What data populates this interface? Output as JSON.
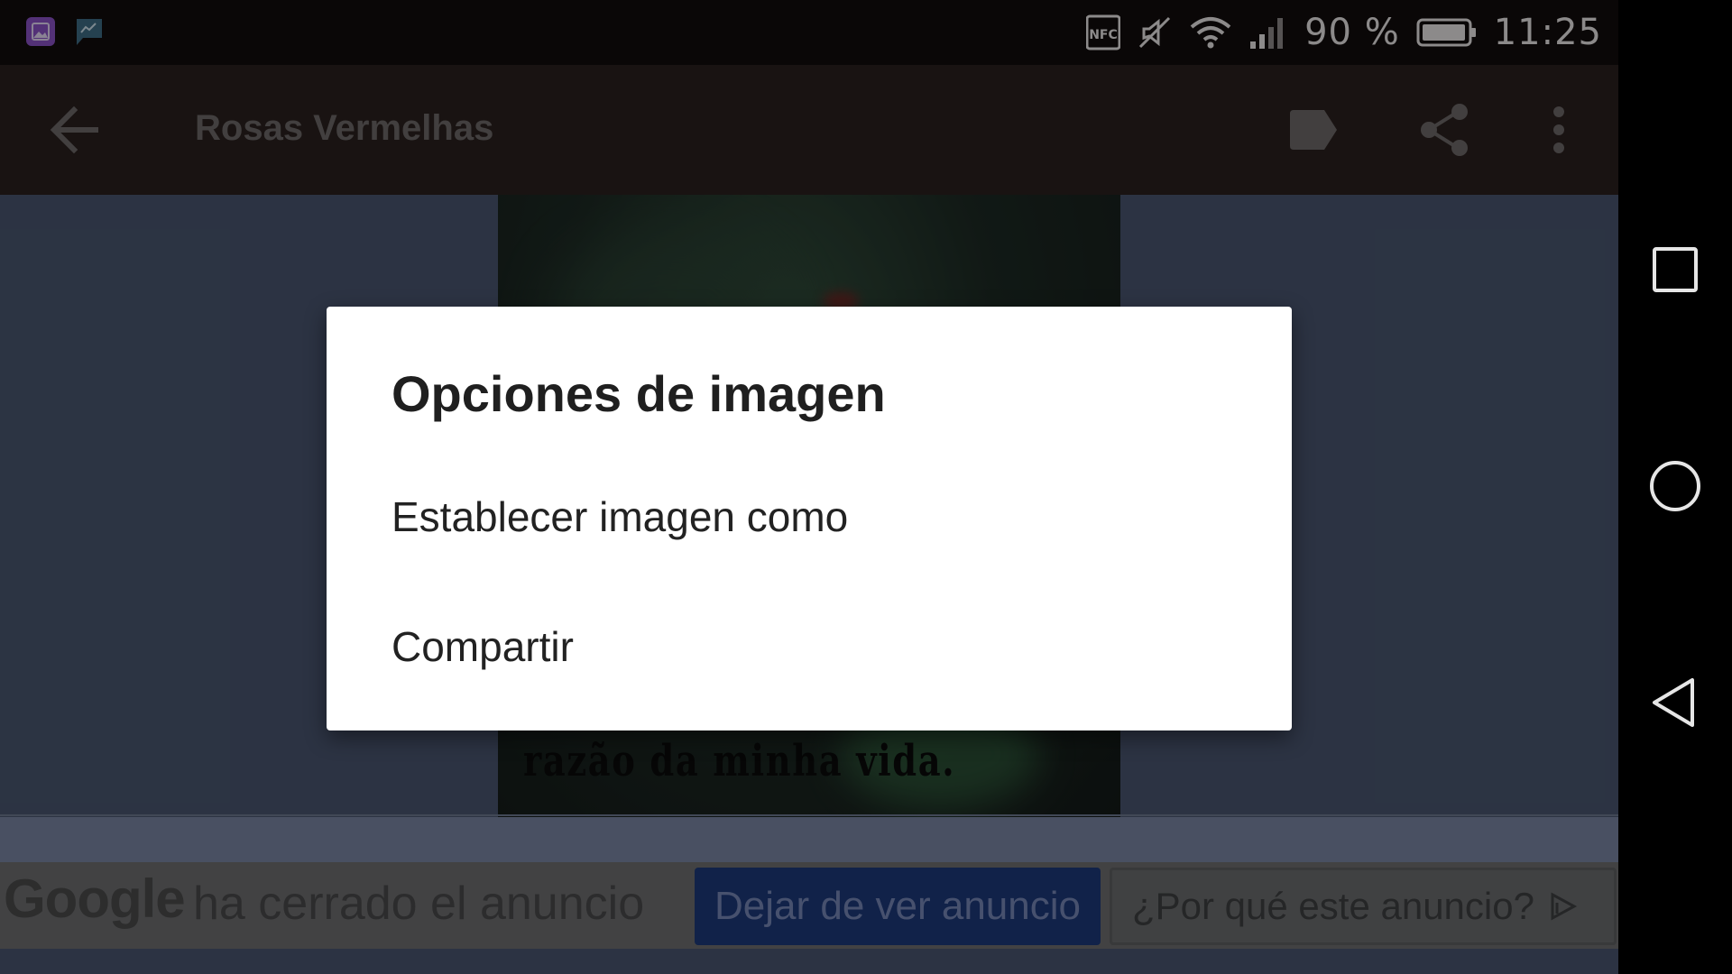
{
  "status_bar": {
    "notifications": [
      "gallery-notification-icon",
      "chart-notification-icon"
    ],
    "indicators": [
      "nfc-icon",
      "vibrate-off-icon",
      "wifi-icon",
      "signal-icon"
    ],
    "battery": "90 %",
    "time": "11:25"
  },
  "app_bar": {
    "title": "Rosas Vermelhas",
    "actions": [
      "label-icon",
      "share-icon",
      "more-vert-icon"
    ]
  },
  "image": {
    "caption": "razão da minha vida."
  },
  "dialog": {
    "title": "Opciones de imagen",
    "items": [
      "Establecer imagen como",
      "Compartir"
    ]
  },
  "ad": {
    "logo": "Google",
    "message": "ha cerrado el anuncio",
    "stop_button": "Dejar de ver anuncio",
    "why_button": "¿Por qué este anuncio?"
  },
  "nav_bar": [
    "recents-icon",
    "home-icon",
    "back-nav-icon"
  ],
  "colors": {
    "status_bar": "#120d0d",
    "app_bar": "#2a211f",
    "content_bg": "#4a5670",
    "dialog_bg": "#ffffff",
    "ad_button": "#1d3a7a"
  }
}
